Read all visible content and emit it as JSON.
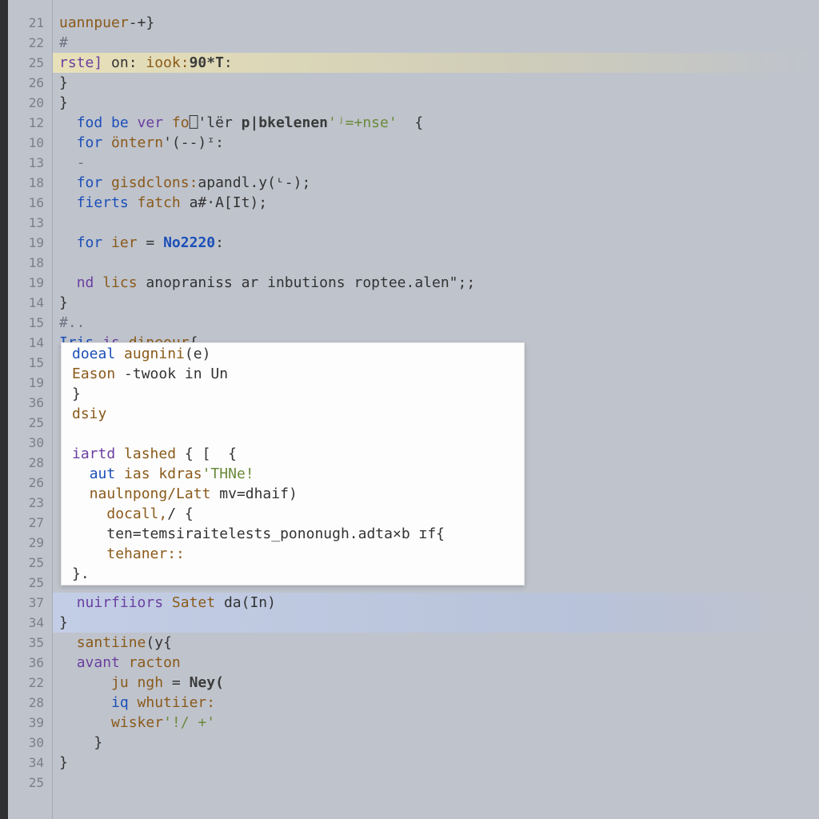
{
  "gutter": [
    "21",
    "22",
    "25",
    "26",
    "20",
    "12",
    "10",
    "13",
    "18",
    "16",
    "13",
    "19",
    "18",
    "19",
    "14",
    "15",
    "14",
    "15",
    "19",
    "36",
    "25",
    "30",
    "28",
    "26",
    "23",
    "27",
    "29",
    "25",
    "25",
    "37",
    "34",
    "35",
    "36",
    "22",
    "28",
    "39",
    "30",
    "34",
    "25"
  ],
  "lines": [
    {
      "indent": 0,
      "hl": "",
      "tokens": [
        {
          "t": "uannpuer",
          "c": "id"
        },
        {
          "t": "-+}",
          "c": "punc"
        }
      ]
    },
    {
      "indent": 0,
      "hl": "",
      "tokens": [
        {
          "t": "#",
          "c": "pale"
        }
      ]
    },
    {
      "indent": 0,
      "hl": "yellow",
      "tokens": [
        {
          "t": "rste]",
          "c": "kw"
        },
        {
          "t": " on: ",
          "c": "punc"
        },
        {
          "t": "iook:",
          "c": "id"
        },
        {
          "t": "90*T",
          "c": "fn"
        },
        {
          "t": ":",
          "c": "punc"
        }
      ]
    },
    {
      "indent": 0,
      "hl": "",
      "tokens": [
        {
          "t": "}",
          "c": "punc"
        }
      ]
    },
    {
      "indent": 0,
      "hl": "",
      "tokens": [
        {
          "t": "}",
          "c": "punc"
        }
      ]
    },
    {
      "indent": 1,
      "hl": "",
      "tokens": [
        {
          "t": "fod be ",
          "c": "kw2"
        },
        {
          "t": "ver ",
          "c": "kw"
        },
        {
          "t": "fo",
          "c": "id"
        },
        {
          "t": "⎕'lër ",
          "c": "punc"
        },
        {
          "t": "p|bkelenen",
          "c": "fn"
        },
        {
          "t": "'ʲ=+nse'",
          "c": "str"
        },
        {
          "t": "  {",
          "c": "punc"
        }
      ]
    },
    {
      "indent": 1,
      "hl": "",
      "tokens": [
        {
          "t": "for ",
          "c": "kw2"
        },
        {
          "t": "öntern",
          "c": "id"
        },
        {
          "t": "'(--)",
          "c": "punc"
        },
        {
          "t": "ᶦ:",
          "c": "punc"
        }
      ]
    },
    {
      "indent": 1,
      "hl": "",
      "tokens": [
        {
          "t": "-",
          "c": "pale"
        }
      ]
    },
    {
      "indent": 1,
      "hl": "",
      "tokens": [
        {
          "t": "for ",
          "c": "kw2"
        },
        {
          "t": "gisdclons:",
          "c": "id"
        },
        {
          "t": "apandl.y(ᶫ-);",
          "c": "punc"
        }
      ]
    },
    {
      "indent": 1,
      "hl": "",
      "tokens": [
        {
          "t": "fierts ",
          "c": "kw2"
        },
        {
          "t": "fatch ",
          "c": "id"
        },
        {
          "t": "a#·A[It);",
          "c": "punc"
        }
      ]
    },
    {
      "indent": 0,
      "hl": "",
      "tokens": []
    },
    {
      "indent": 1,
      "hl": "",
      "tokens": [
        {
          "t": "for ",
          "c": "kw2"
        },
        {
          "t": "ier ",
          "c": "id"
        },
        {
          "t": "= ",
          "c": "punc"
        },
        {
          "t": "No2220",
          "c": "num"
        },
        {
          "t": ":",
          "c": "punc"
        }
      ]
    },
    {
      "indent": 0,
      "hl": "",
      "tokens": []
    },
    {
      "indent": 1,
      "hl": "",
      "tokens": [
        {
          "t": "nd ",
          "c": "kw"
        },
        {
          "t": "lics ",
          "c": "id"
        },
        {
          "t": "anopraniss ar inbutions roptee.alen\";;",
          "c": "punc"
        }
      ]
    },
    {
      "indent": 0,
      "hl": "",
      "tokens": [
        {
          "t": "}",
          "c": "punc"
        }
      ]
    },
    {
      "indent": 0,
      "hl": "",
      "tokens": [
        {
          "t": "#..",
          "c": "pale"
        }
      ]
    },
    {
      "indent": 0,
      "hl": "",
      "tokens": [
        {
          "t": "Iris ",
          "c": "kw2"
        },
        {
          "t": "is ",
          "c": "kw"
        },
        {
          "t": "dineour",
          "c": "id"
        },
        {
          "t": "{",
          "c": "punc"
        }
      ]
    },
    {
      "popup": true
    },
    {
      "popup": true
    },
    {
      "popup": true
    },
    {
      "popup": true
    },
    {
      "popup": true
    },
    {
      "popup": true
    },
    {
      "popup": true
    },
    {
      "popup": true
    },
    {
      "popup": true
    },
    {
      "popup": true
    },
    {
      "popup": true
    },
    {
      "popup": true
    },
    {
      "indent": 1,
      "hl": "blue",
      "tokens": [
        {
          "t": "nuirfiiors ",
          "c": "kw"
        },
        {
          "t": "Satet ",
          "c": "id"
        },
        {
          "t": "da(In)",
          "c": "punc"
        }
      ]
    },
    {
      "indent": 0,
      "hl": "blue",
      "tokens": [
        {
          "t": "}",
          "c": "punc"
        }
      ]
    },
    {
      "indent": 1,
      "hl": "",
      "tokens": [
        {
          "t": "santiine",
          "c": "id"
        },
        {
          "t": "(y{",
          "c": "punc"
        }
      ]
    },
    {
      "indent": 1,
      "hl": "",
      "tokens": [
        {
          "t": "avant ",
          "c": "kw"
        },
        {
          "t": "racton",
          "c": "id"
        }
      ]
    },
    {
      "indent": 3,
      "hl": "",
      "tokens": [
        {
          "t": "ju ngh ",
          "c": "id"
        },
        {
          "t": "= ",
          "c": "punc"
        },
        {
          "t": "Ney(",
          "c": "fn"
        }
      ]
    },
    {
      "indent": 3,
      "hl": "",
      "tokens": [
        {
          "t": "iq ",
          "c": "kw2"
        },
        {
          "t": "whutiier:",
          "c": "id"
        }
      ]
    },
    {
      "indent": 3,
      "hl": "",
      "tokens": [
        {
          "t": "wisker",
          "c": "id"
        },
        {
          "t": "'!/ +'",
          "c": "str"
        }
      ]
    },
    {
      "indent": 2,
      "hl": "",
      "tokens": [
        {
          "t": "}",
          "c": "punc"
        }
      ]
    },
    {
      "indent": 0,
      "hl": "",
      "tokens": [
        {
          "t": "}",
          "c": "punc"
        }
      ]
    }
  ],
  "popup": [
    {
      "indent": 0,
      "tokens": [
        {
          "t": "doeal ",
          "c": "kw2"
        },
        {
          "t": "augnini",
          "c": "id"
        },
        {
          "t": "(e)",
          "c": "punc"
        }
      ]
    },
    {
      "indent": 0,
      "tokens": [
        {
          "t": "Eason ",
          "c": "id"
        },
        {
          "t": "-twook in Un",
          "c": "punc"
        }
      ]
    },
    {
      "indent": 0,
      "tokens": [
        {
          "t": "}",
          "c": "punc"
        }
      ]
    },
    {
      "indent": 0,
      "tokens": [
        {
          "t": "dsiy",
          "c": "id"
        }
      ]
    },
    {
      "indent": 0,
      "tokens": []
    },
    {
      "indent": 0,
      "tokens": [
        {
          "t": "iartd ",
          "c": "kw"
        },
        {
          "t": "lashed ",
          "c": "id"
        },
        {
          "t": "{ [  {",
          "c": "punc"
        }
      ]
    },
    {
      "indent": 1,
      "tokens": [
        {
          "t": "aut ",
          "c": "kw2"
        },
        {
          "t": "ias kdras",
          "c": "id"
        },
        {
          "t": "'THNe!",
          "c": "str"
        }
      ]
    },
    {
      "indent": 1,
      "tokens": [
        {
          "t": "naulnpong/Latt ",
          "c": "id"
        },
        {
          "t": "mv=dhaif)",
          "c": "punc"
        }
      ]
    },
    {
      "indent": 2,
      "tokens": [
        {
          "t": "docall,",
          "c": "id"
        },
        {
          "t": "/ {",
          "c": "punc"
        }
      ]
    },
    {
      "indent": 2,
      "tokens": [
        {
          "t": "ten=temsiraitelests_pononugh.adta×b ɪf{",
          "c": "punc"
        }
      ]
    },
    {
      "indent": 2,
      "tokens": [
        {
          "t": "tehaner::",
          "c": "id"
        }
      ]
    },
    {
      "indent": 0,
      "tokens": [
        {
          "t": "}.",
          "c": "punc"
        }
      ]
    }
  ]
}
